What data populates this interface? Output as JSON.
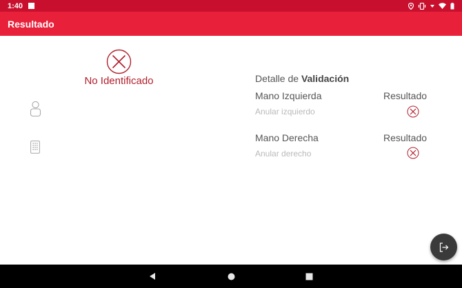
{
  "status_bar": {
    "time": "1:40",
    "icons": [
      "notification-square-icon",
      "location-icon",
      "vibrate-icon",
      "wifi-icon",
      "signal-icon",
      "battery-icon"
    ]
  },
  "app_bar": {
    "title": "Resultado"
  },
  "result": {
    "status_icon": "circle-x-icon",
    "label": "No Identificado"
  },
  "side_icons": [
    "person-icon",
    "keypad-icon"
  ],
  "validation": {
    "title_prefix": "Detalle de ",
    "title_bold": "Validación",
    "result_header": "Resultado",
    "hands": [
      {
        "name": "Mano Izquierda",
        "finger": "Anular izquierdo",
        "result_icon": "circle-x-icon"
      },
      {
        "name": "Mano Derecha",
        "finger": "Anular derecho",
        "result_icon": "circle-x-icon"
      }
    ]
  },
  "fab": {
    "icon": "exit-icon"
  },
  "nav_bar": {
    "buttons": [
      "back-icon",
      "home-icon",
      "recents-icon"
    ]
  },
  "colors": {
    "status_bar": "#c8102e",
    "app_bar": "#e8203a",
    "error": "#b01d2a",
    "fab": "#3a3a3a"
  }
}
